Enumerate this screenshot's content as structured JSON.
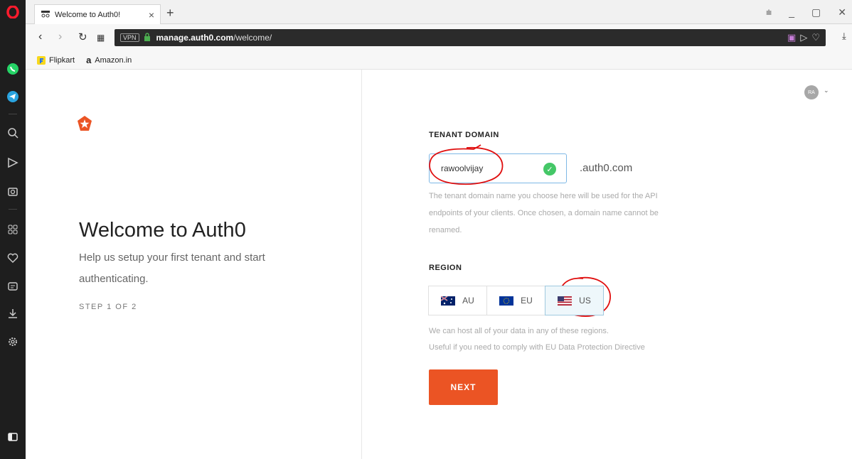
{
  "browser": {
    "tab_title": "Welcome to Auth0!",
    "url_domain": "manage.auth0.com",
    "url_path": "/welcome/",
    "vpn_label": "VPN",
    "bookmarks": [
      {
        "label": "Flipkart"
      },
      {
        "label": "Amazon.in"
      }
    ]
  },
  "user": {
    "initials": "RA"
  },
  "left": {
    "title": "Welcome to Auth0",
    "subtitle": "Help us setup your first tenant and start authenticating.",
    "step": "STEP 1 OF 2"
  },
  "form": {
    "tenant_label": "TENANT DOMAIN",
    "tenant_value": "rawoolvijay",
    "tenant_suffix": ".auth0.com",
    "tenant_help_lines": [
      "The tenant domain name you choose here will be used for the API",
      "endpoints of your clients. Once chosen, a domain name cannot be",
      "renamed."
    ],
    "region_label": "REGION",
    "regions": [
      {
        "code": "AU",
        "selected": false
      },
      {
        "code": "EU",
        "selected": false
      },
      {
        "code": "US",
        "selected": true
      }
    ],
    "region_help_lines": [
      "We can host all of your data in any of these regions.",
      "Useful if you need to comply with EU Data Protection Directive"
    ],
    "next_label": "NEXT"
  },
  "colors": {
    "accent": "#eb5424",
    "valid": "#44c767",
    "annotation": "#e01010"
  }
}
